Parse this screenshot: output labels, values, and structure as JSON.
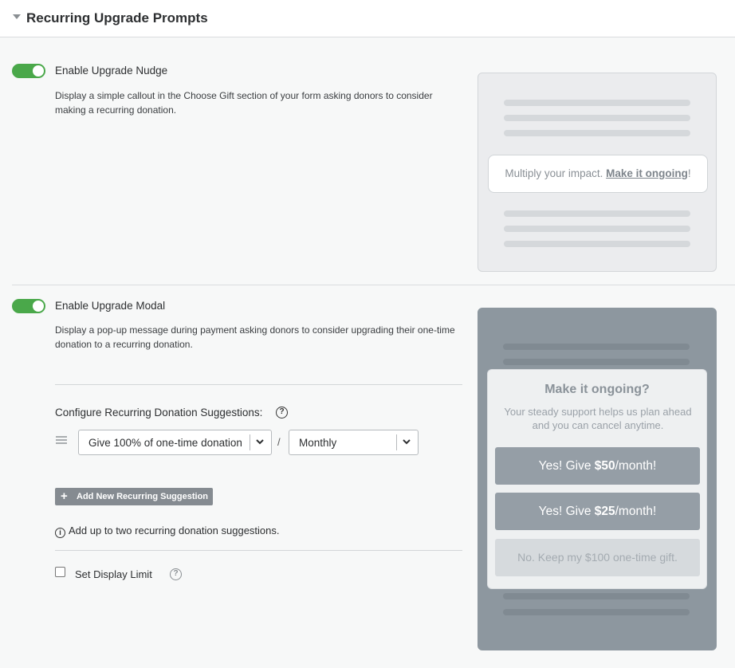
{
  "header": {
    "title": "Recurring Upgrade Prompts"
  },
  "nudge": {
    "toggle_on": true,
    "label": "Enable Upgrade Nudge",
    "description": "Display a simple callout in the Choose Gift section of your form asking donors to consider making a recurring donation.",
    "preview": {
      "text": "Multiply your impact. ",
      "link": "Make it ongoing",
      "suffix": "!"
    }
  },
  "modal": {
    "toggle_on": true,
    "label": "Enable Upgrade Modal",
    "description": "Display a pop-up message during payment asking donors to consider upgrading their one-time donation to a recurring donation.",
    "config_label": "Configure Recurring Donation Suggestions:",
    "help_glyph": "?",
    "suggestion": {
      "amount_select": "Give 100% of one-time donation",
      "separator": "/",
      "frequency_select": "Monthly"
    },
    "add_button": "Add New Recurring Suggestion",
    "add_icon": "+",
    "info_glyph": "i",
    "info_text": "Add up to two recurring donation suggestions.",
    "display_limit_label": "Set Display Limit",
    "display_limit_checked": false,
    "preview": {
      "title": "Make it ongoing?",
      "text": "Your steady support helps us plan ahead and you can cancel anytime.",
      "btn1_prefix": "Yes! Give ",
      "btn1_amount": "$50",
      "btn1_suffix": "/month!",
      "btn2_prefix": "Yes! Give ",
      "btn2_amount": "$25",
      "btn2_suffix": "/month!",
      "decline": "No. Keep my $100 one-time gift."
    }
  }
}
